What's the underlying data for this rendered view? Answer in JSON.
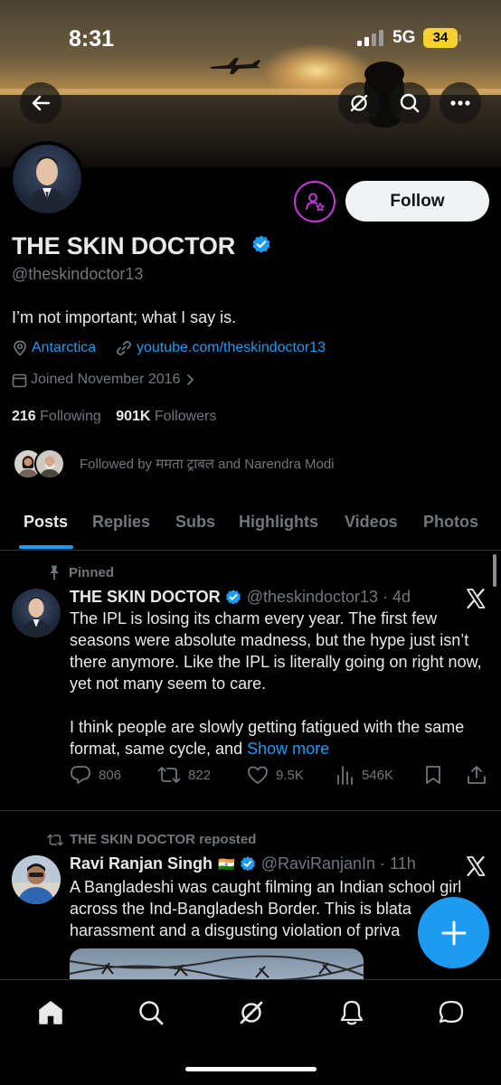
{
  "status_bar": {
    "time": "8:31",
    "network": "5G",
    "battery": "34"
  },
  "profile": {
    "name": "THE SKIN DOCTOR",
    "handle": "@theskindoctor13",
    "bio": "I’m not important; what I say is.",
    "location": "Antarctica",
    "website": "youtube.com/theskindoctor13",
    "joined": "Joined November 2016",
    "following_count": "216",
    "following_label": "Following",
    "followers_count": "901K",
    "followers_label": "Followers",
    "followed_by": "Followed by ममता ट्राबल and Narendra Modi",
    "follow_label": "Follow"
  },
  "tabs": [
    "Posts",
    "Replies",
    "Subs",
    "Highlights",
    "Videos",
    "Photos"
  ],
  "posts": [
    {
      "context": "Pinned",
      "author": "THE SKIN DOCTOR",
      "handle": "@theskindoctor13 · 4d",
      "text_p1": "The IPL is losing its charm every year. The first few seasons were absolute madness, but the hype just isn’t there anymore. Like the IPL is literally going on right now, yet not many seem to care.",
      "text_p2": "I think people are slowly getting fatigued with the same format, same cycle, and",
      "show_more": "Show more",
      "replies": "806",
      "reposts": "822",
      "likes": "9.5K",
      "views": "546K"
    },
    {
      "context": "THE SKIN DOCTOR reposted",
      "author": "Ravi Ranjan Singh",
      "flag": "🇮🇳",
      "handle": "@RaviRanjanIn · 11h",
      "text": "A Bangladeshi  was caught filming an Indian school girl across the Ind-Bangladesh Border. This is blata harassment and a disgusting violation of priva"
    }
  ],
  "colors": {
    "accent": "#1d9bf0",
    "subs_ring": "#c23cd4",
    "battery": "#f7d031"
  },
  "icons": [
    "back-arrow-icon",
    "grok-icon",
    "search-icon",
    "more-icon",
    "subscribe-person-icon",
    "verified-icon",
    "location-icon",
    "link-icon",
    "calendar-icon",
    "pin-icon",
    "x-logo-icon",
    "reply-icon",
    "repost-icon",
    "like-icon",
    "views-icon",
    "bookmark-icon",
    "share-icon",
    "plus-icon",
    "home-icon",
    "notifications-icon",
    "messages-icon"
  ]
}
